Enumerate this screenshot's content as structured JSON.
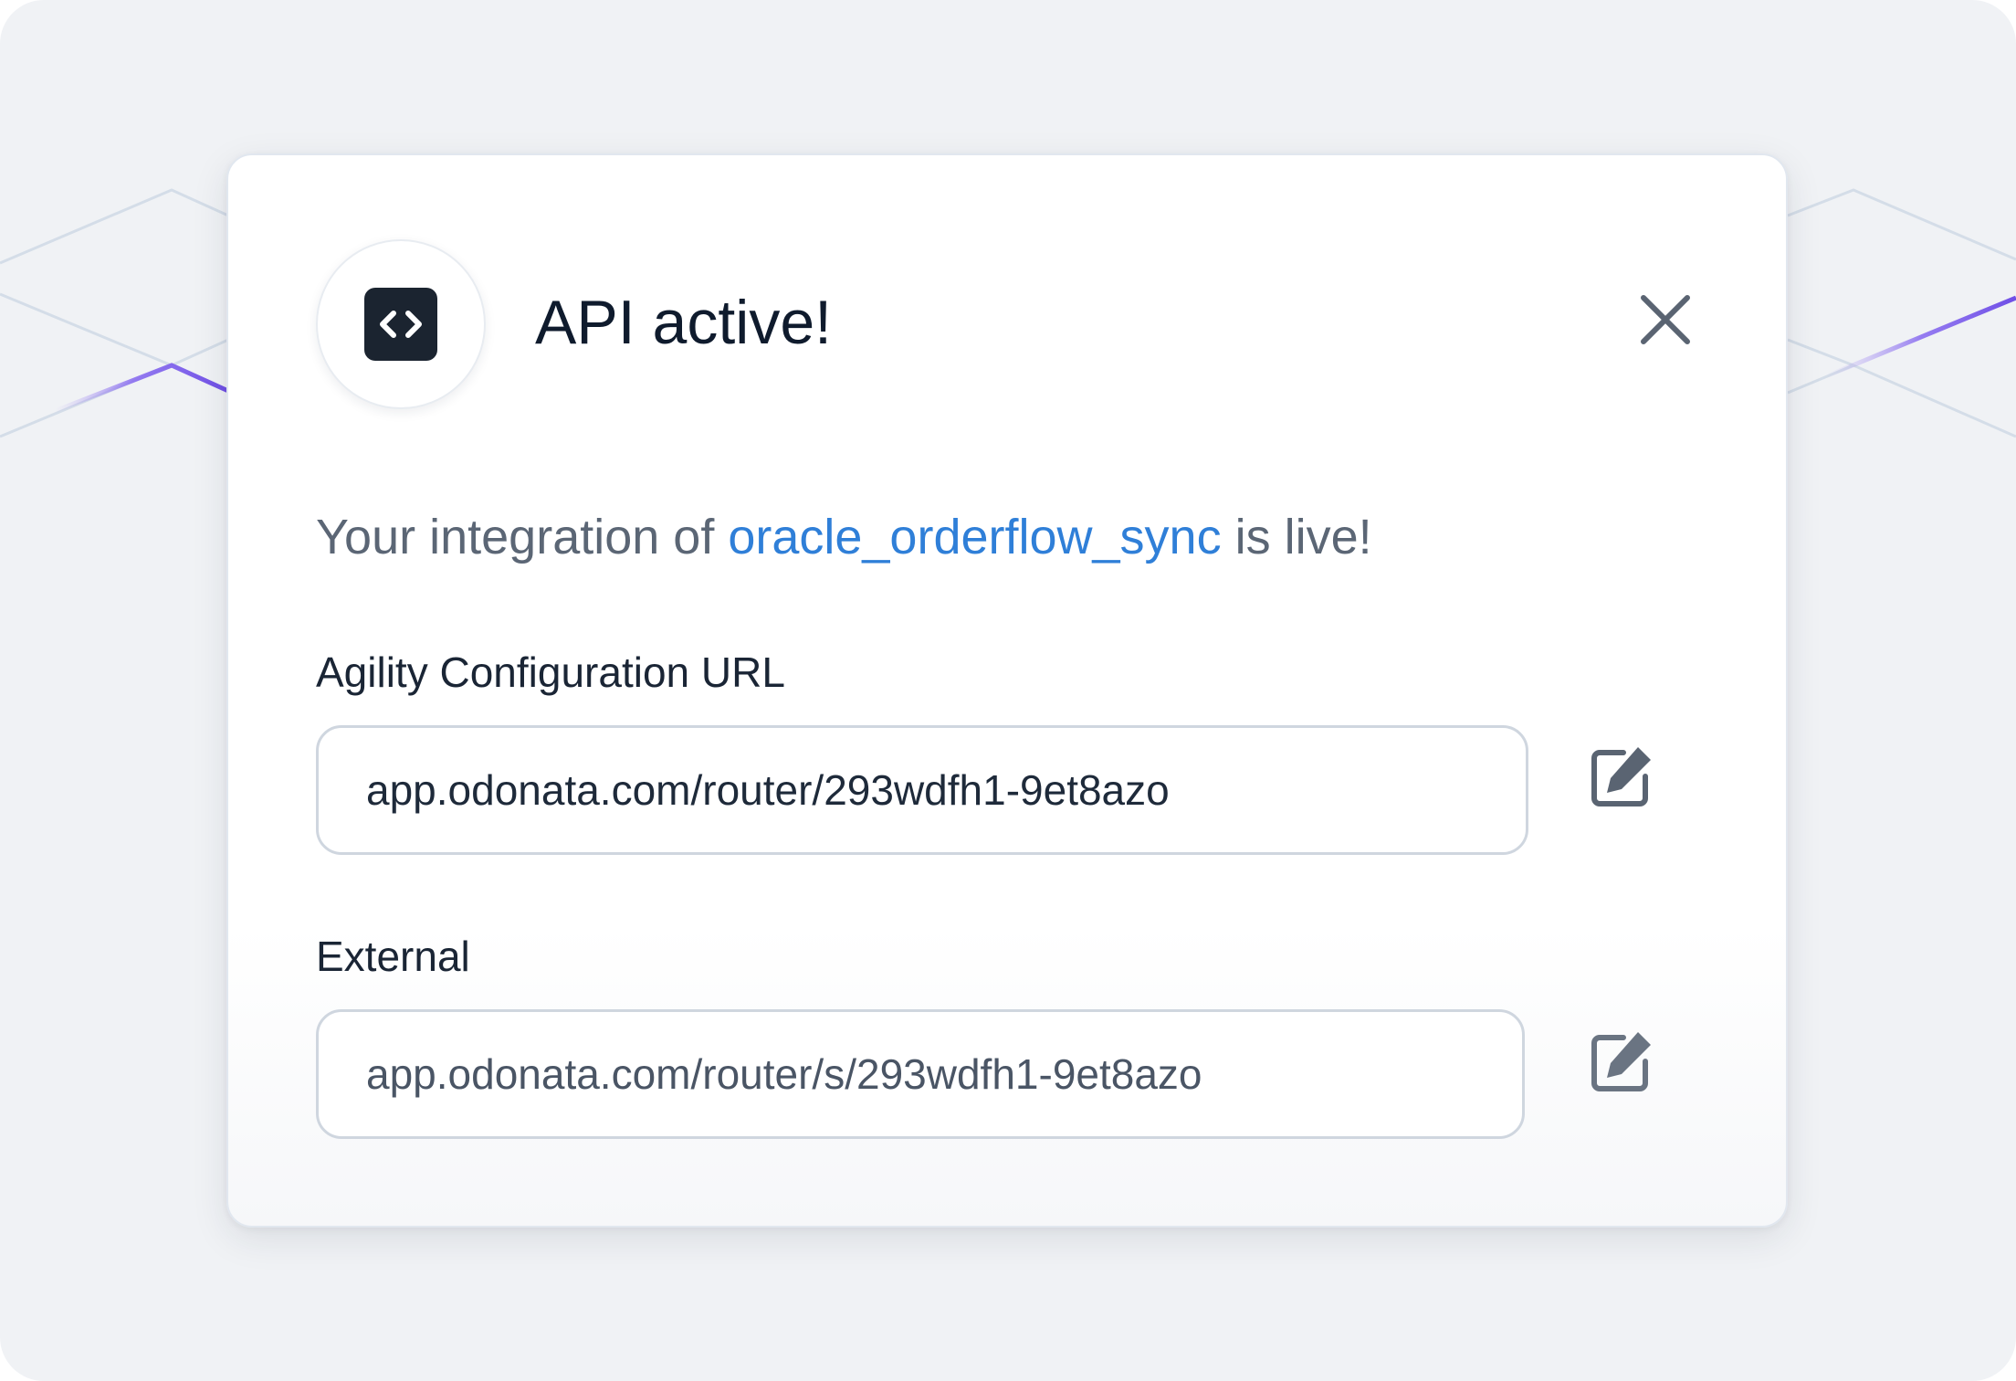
{
  "modal": {
    "title": "API active!",
    "icon": "code-icon",
    "close_icon": "close-icon"
  },
  "message": {
    "prefix": "Your integration of ",
    "integration_name": "oracle_orderflow_sync",
    "suffix": " is live!"
  },
  "fields": [
    {
      "label": "Agility Configuration URL",
      "value": "app.odonata.com/router/293wdfh1-9et8azo",
      "edit_icon": "edit-icon"
    },
    {
      "label": "External",
      "value": "app.odonata.com/router/s/293wdfh1-9et8azo",
      "edit_icon": "edit-icon"
    }
  ],
  "colors": {
    "background": "#f0f2f5",
    "accent_link": "#2f7fd8",
    "accent_line": "#7b5ce6",
    "icon_dark": "#1b2430",
    "text_primary": "#0f1b2d",
    "text_secondary": "#5b6675"
  }
}
